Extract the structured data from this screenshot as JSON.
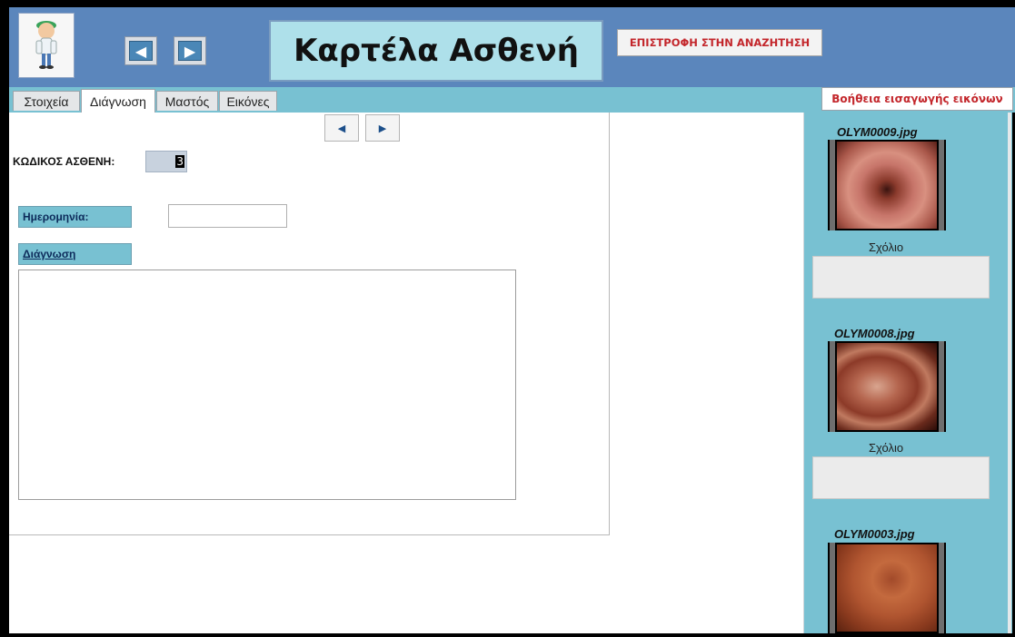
{
  "header": {
    "title": "Καρτέλα Ασθενή",
    "return_button": "ΕΠΙΣΤΡΟΦΗ ΣΤΗΝ ΑΝΑΖΗΤΗΣΗ",
    "back_icon": "arrow-left-icon",
    "forward_icon": "arrow-right-icon",
    "avatar_icon": "doctor-icon"
  },
  "tabs": [
    {
      "label": "Στοιχεία",
      "active": false
    },
    {
      "label": "Διάγνωση",
      "active": true
    },
    {
      "label": "Μαστός",
      "active": false
    },
    {
      "label": "Εικόνες",
      "active": false
    }
  ],
  "help_button": "Βοήθεια εισαγωγής εικόνων",
  "form": {
    "code_label": "ΚΩΔΙΚΟΣ ΑΣΘΕΝΗ:",
    "code_value": "3",
    "date_label": "Ημερομηνία:",
    "date_value": "",
    "diagnosis_label": "Διάγνωση",
    "diagnosis_value": ""
  },
  "record_nav": {
    "prev_icon": "triangle-left-icon",
    "next_icon": "triangle-right-icon"
  },
  "images": [
    {
      "filename": "OLYM0009.jpg",
      "comment_label": "Σχόλιο",
      "comment": ""
    },
    {
      "filename": "OLYM0008.jpg",
      "comment_label": "Σχόλιο",
      "comment": ""
    },
    {
      "filename": "OLYM0003.jpg"
    }
  ],
  "colors": {
    "header": "#5b86bc",
    "panel": "#78c1d2",
    "accent_red": "#c3262b",
    "title_box": "#aee0ea"
  }
}
